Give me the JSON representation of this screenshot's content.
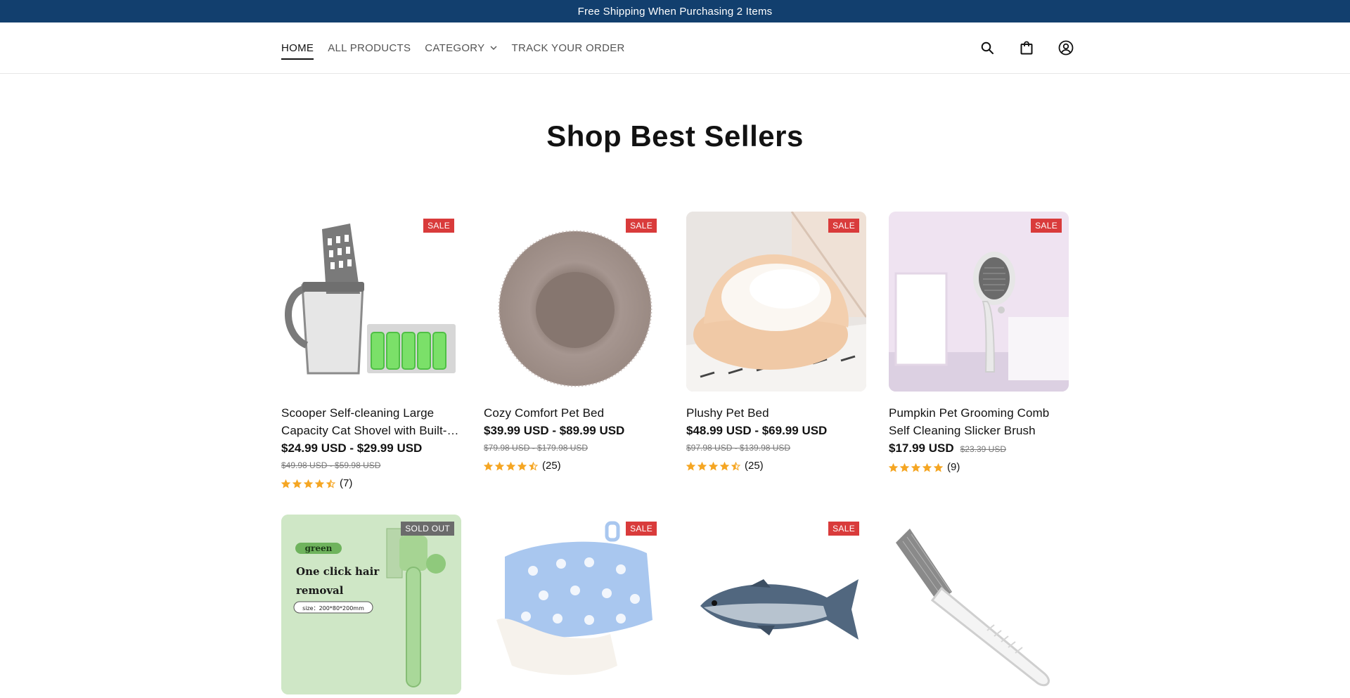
{
  "announcement": {
    "text": "Free Shipping When Purchasing 2 Items"
  },
  "nav": {
    "home": "HOME",
    "all_products": "ALL PRODUCTS",
    "category": "CATEGORY",
    "track": "TRACK YOUR ORDER"
  },
  "icons": {
    "search": "search-icon",
    "cart": "bag-icon",
    "account": "account-icon"
  },
  "section": {
    "title": "Shop Best Sellers"
  },
  "products": [
    {
      "title": "Scooper Self-cleaning Large Capacity Cat Shovel with Built-in Bag Holder",
      "price": "$24.99 USD - $29.99 USD",
      "compare": "$49.98 USD - $59.98 USD",
      "count": "(7)",
      "badge": "SALE"
    },
    {
      "title": "Cozy Comfort Pet Bed",
      "price": "$39.99 USD - $89.99 USD",
      "compare": "$79.98 USD - $179.98 USD",
      "count": "(25)",
      "badge": "SALE"
    },
    {
      "title": "Plushy Pet Bed",
      "price": "$48.99 USD - $69.99 USD",
      "compare": "$97.98 USD - $139.98 USD",
      "count": "(25)",
      "badge": "SALE"
    },
    {
      "title": "Pumpkin Pet Grooming Comb Self Cleaning Slicker Brush",
      "price": "$17.99 USD",
      "compare": "$23.39 USD",
      "count": "(9)",
      "badge": "SALE"
    },
    {
      "badge": "SOLD OUT",
      "image_text": {
        "tag": "green",
        "line1": "One click hair",
        "line2": "removal",
        "size": "size：200*80*200mm"
      }
    },
    {
      "badge": "SALE"
    },
    {
      "badge": "SALE"
    },
    {
      "badge": ""
    }
  ],
  "ratings": [
    4.5,
    4.5,
    4.5,
    5
  ],
  "colors": {
    "announcement": "#123f6e",
    "sale": "#d93b3b",
    "star": "#f5a623",
    "soldout": "#6b6b6b"
  }
}
